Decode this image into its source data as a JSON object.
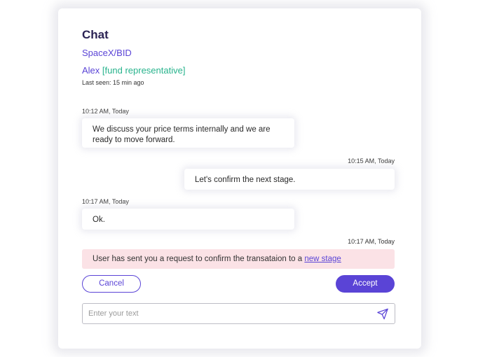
{
  "chat": {
    "title": "Chat",
    "deal": "SpaceX/BID",
    "contact_name": "Alex",
    "contact_role_open": "[",
    "contact_role": "fund representative",
    "contact_role_close": "]",
    "last_seen": "Last seen: 15 min ago"
  },
  "messages": [
    {
      "time": "10:12 AM, Today",
      "text": "We discuss your price terms internally and we are ready to move forward.",
      "side": "left"
    },
    {
      "time": "10:15 AM, Today",
      "text": "Let's confirm the next stage.",
      "side": "right"
    },
    {
      "time": "10:17 AM, Today",
      "text": "Ok.",
      "side": "left"
    },
    {
      "time": "10:17 AM, Today",
      "side": "right"
    }
  ],
  "notice": {
    "text": "User has sent you a request to confirm the transataion to a ",
    "link": "new stage"
  },
  "actions": {
    "cancel_label": "Cancel",
    "accept_label": "Accept"
  },
  "composer": {
    "placeholder": "Enter your text",
    "value": "",
    "send_icon": "send-icon"
  },
  "colors": {
    "accent": "#5a44d6",
    "role_green": "#27b38c",
    "title_dark": "#2b2354",
    "notice_bg": "#fbe2e6"
  }
}
